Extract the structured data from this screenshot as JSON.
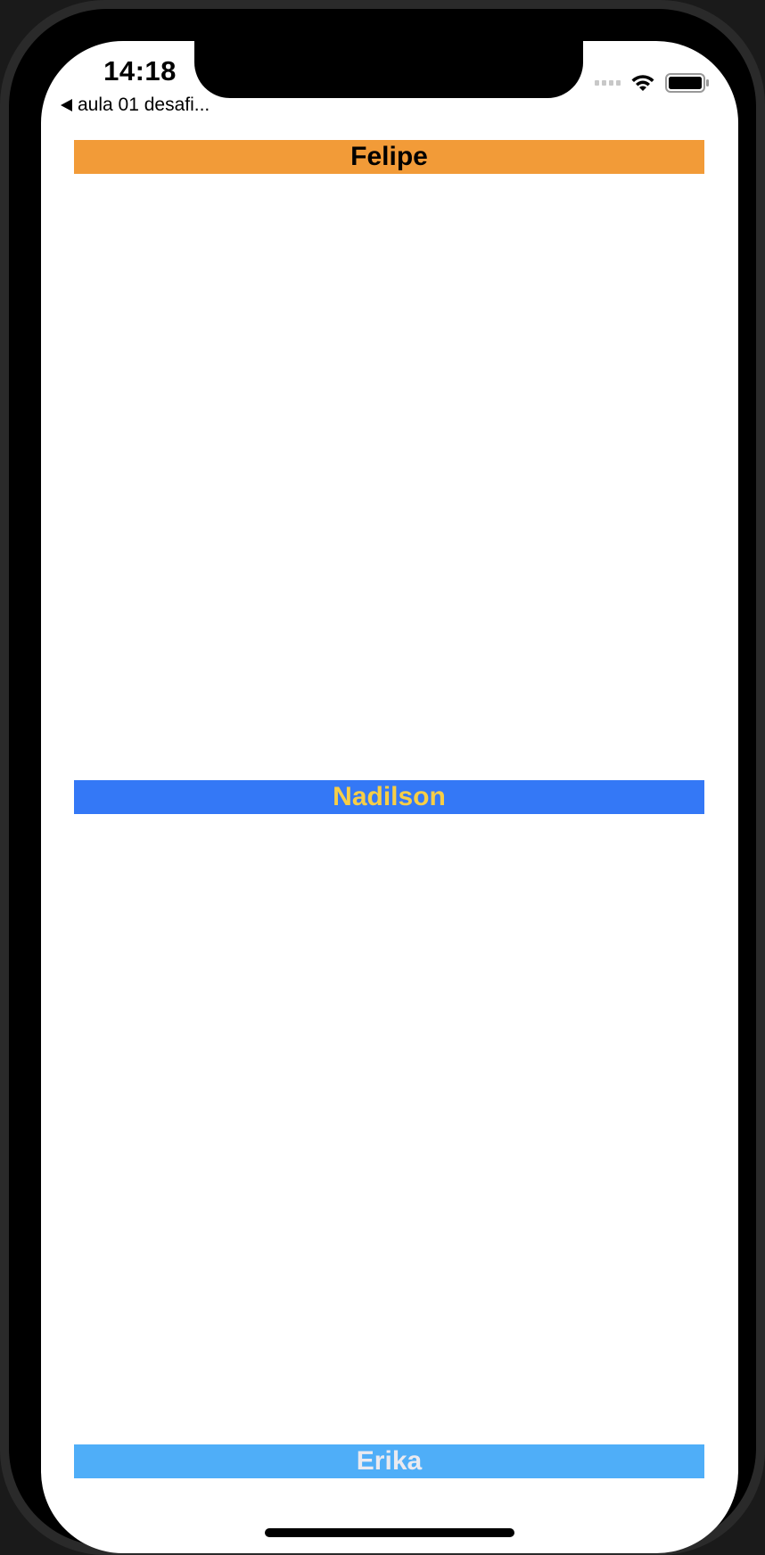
{
  "status_bar": {
    "time": "14:18",
    "back_label": "aula 01 desafi..."
  },
  "names": [
    {
      "label": "Felipe",
      "background": "#F29B38",
      "text_color": "#000000"
    },
    {
      "label": "Nadilson",
      "background": "#3478F6",
      "text_color": "#F7CE46"
    },
    {
      "label": "Erika",
      "background": "#4FAEF8",
      "text_color": "#EAEAF0"
    }
  ],
  "icons": {
    "signal": "cellular-signal-icon",
    "wifi": "wifi-icon",
    "battery": "battery-icon",
    "back": "back-arrow-icon"
  }
}
